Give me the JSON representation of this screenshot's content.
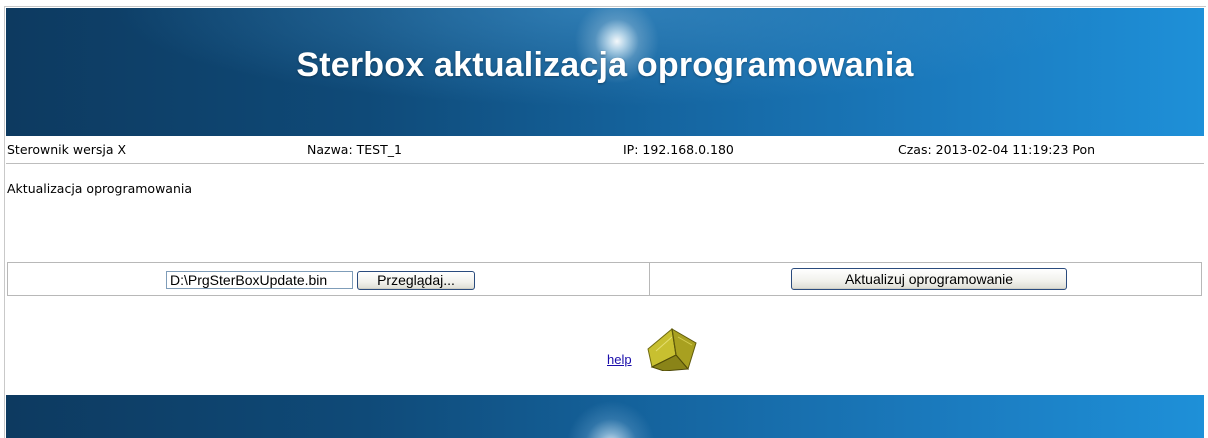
{
  "header": {
    "title": "Sterbox aktualizacja oprogramowania"
  },
  "status_bar": {
    "version": "Sterownik wersja X",
    "name": "Nazwa: TEST_1",
    "ip": "IP: 192.168.0.180",
    "time": "Czas: 2013-02-04 11:19:23 Pon"
  },
  "main": {
    "heading": "Aktualizacja oprogramowania",
    "upload": {
      "file_value": "D:\\PrgSterBoxUpdate.bin",
      "browse_label": "Przeglądaj...",
      "update_label": "Aktualizuj oprogramowanie"
    },
    "help": {
      "label": "help ",
      "icon": "book-icon"
    }
  },
  "colors": {
    "banner_dark": "#0d3a60",
    "banner_light": "#1e90d8",
    "link": "#1a0dab"
  }
}
